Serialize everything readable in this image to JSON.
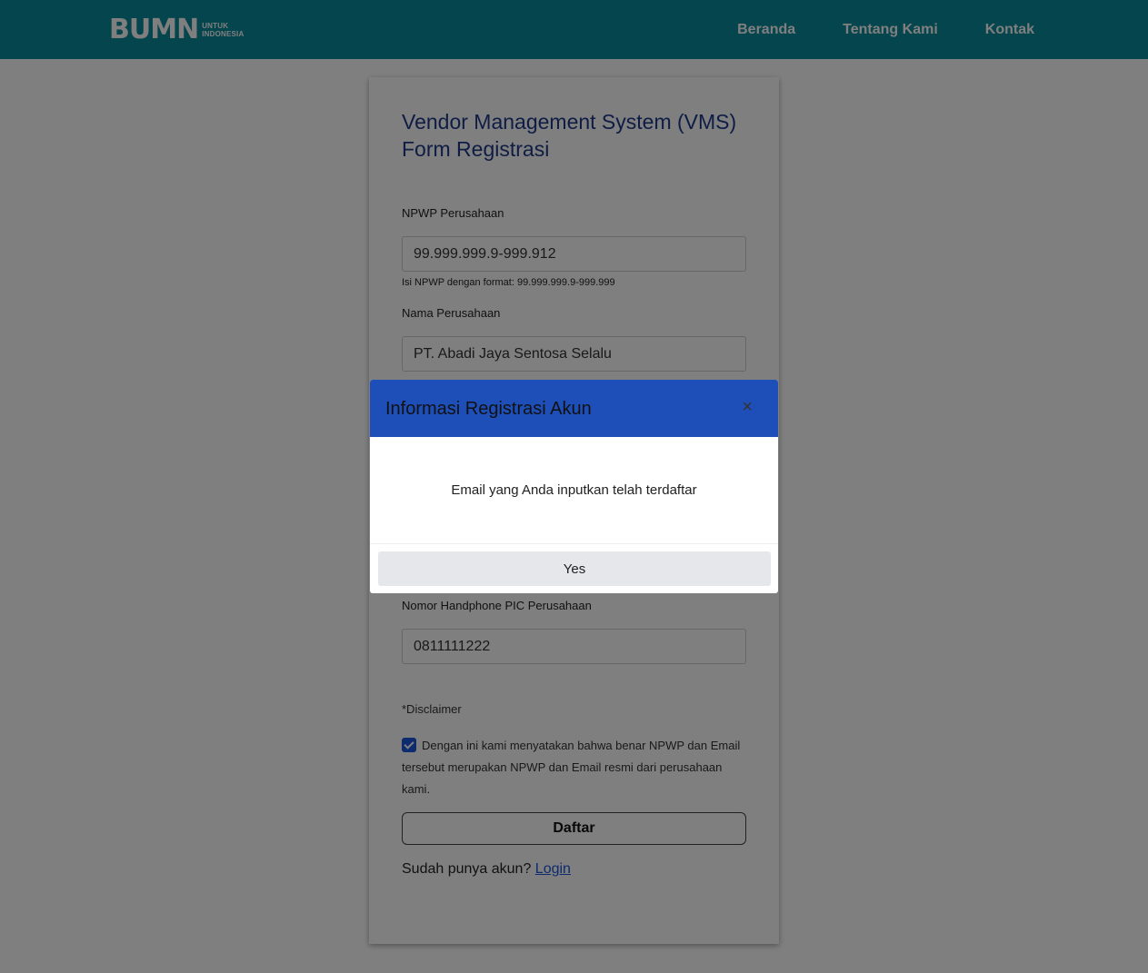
{
  "navbar": {
    "logo_mark": "BUMN",
    "logo_line1": "UNTUK",
    "logo_line2": "INDONESIA",
    "links": [
      "Beranda",
      "Tentang Kami",
      "Kontak"
    ]
  },
  "form": {
    "title_line1": "Vendor Management System (VMS)",
    "title_line2": "Form Registrasi",
    "npwp_label": "NPWP Perusahaan",
    "npwp_value": "99.999.999.9-999.912",
    "npwp_hint": "Isi NPWP dengan format: 99.999.999.9-999.999",
    "nama_label": "Nama Perusahaan",
    "nama_value": "PT. Abadi Jaya Sentosa Selalu",
    "hp_label": "Nomor Handphone PIC Perusahaan",
    "hp_value": "0811111222",
    "disclaimer_title": "*Disclaimer",
    "consent_text": "Dengan ini kami menyatakan bahwa benar NPWP dan Email tersebut merupakan NPWP dan Email resmi dari perusahaan kami.",
    "consent_checked": true,
    "submit_label": "Daftar",
    "login_prompt": "Sudah punya akun?",
    "login_link": "Login"
  },
  "modal": {
    "title": "Informasi Registrasi Akun",
    "close_glyph": "×",
    "message": "Email yang Anda inputkan telah terdaftar",
    "confirm_label": "Yes"
  },
  "colors": {
    "navbar": "#0a8a9a",
    "title": "#1e3a8a",
    "modal_header": "#1e4fb8",
    "checkbox": "#1a56db",
    "link": "#1a56db"
  }
}
